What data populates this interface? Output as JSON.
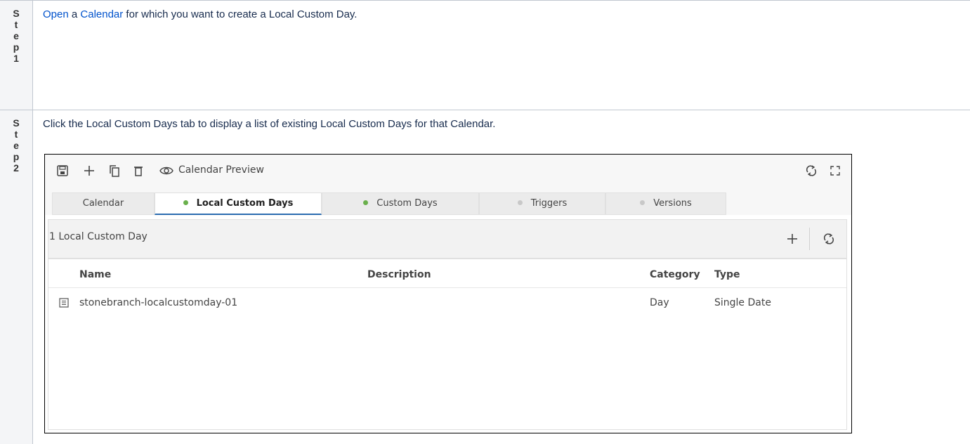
{
  "doc": {
    "step1": {
      "label_chars": [
        "S",
        "t",
        "e",
        "p",
        "1"
      ],
      "link_open": "Open",
      "text_a": " a ",
      "link_calendar": "Calendar",
      "text_b": " for which you want to create a Local Custom Day."
    },
    "step2": {
      "label_chars": [
        "S",
        "t",
        "e",
        "p",
        "2"
      ],
      "text": "Click the Local Custom Days tab to display a list of existing Local Custom Days for that Calendar."
    }
  },
  "app": {
    "toolbar": {
      "icons": [
        "save-icon",
        "add-icon",
        "copy-icon",
        "delete-icon",
        "eye-icon",
        "refresh-icon",
        "expand-icon"
      ],
      "preview_label": "Calendar Preview"
    },
    "tabs": [
      {
        "label": "Calendar",
        "dot": ""
      },
      {
        "label": "Local Custom Days",
        "dot": "green",
        "active": true
      },
      {
        "label": "Custom Days",
        "dot": "green"
      },
      {
        "label": "Triggers",
        "dot": "grey"
      },
      {
        "label": "Versions",
        "dot": "grey"
      }
    ],
    "panel": {
      "title": "1 Local Custom Day",
      "columns": [
        "Name",
        "Description",
        "Category",
        "Type"
      ],
      "rows": [
        {
          "name": "stonebranch-localcustomday-01",
          "description": "",
          "category": "Day",
          "type": "Single Date"
        }
      ]
    },
    "colors": {
      "accent": "#2b6cb0",
      "dot_green": "#6ab04c",
      "dot_grey": "#c8c8c8",
      "link": "#0052cc"
    }
  }
}
